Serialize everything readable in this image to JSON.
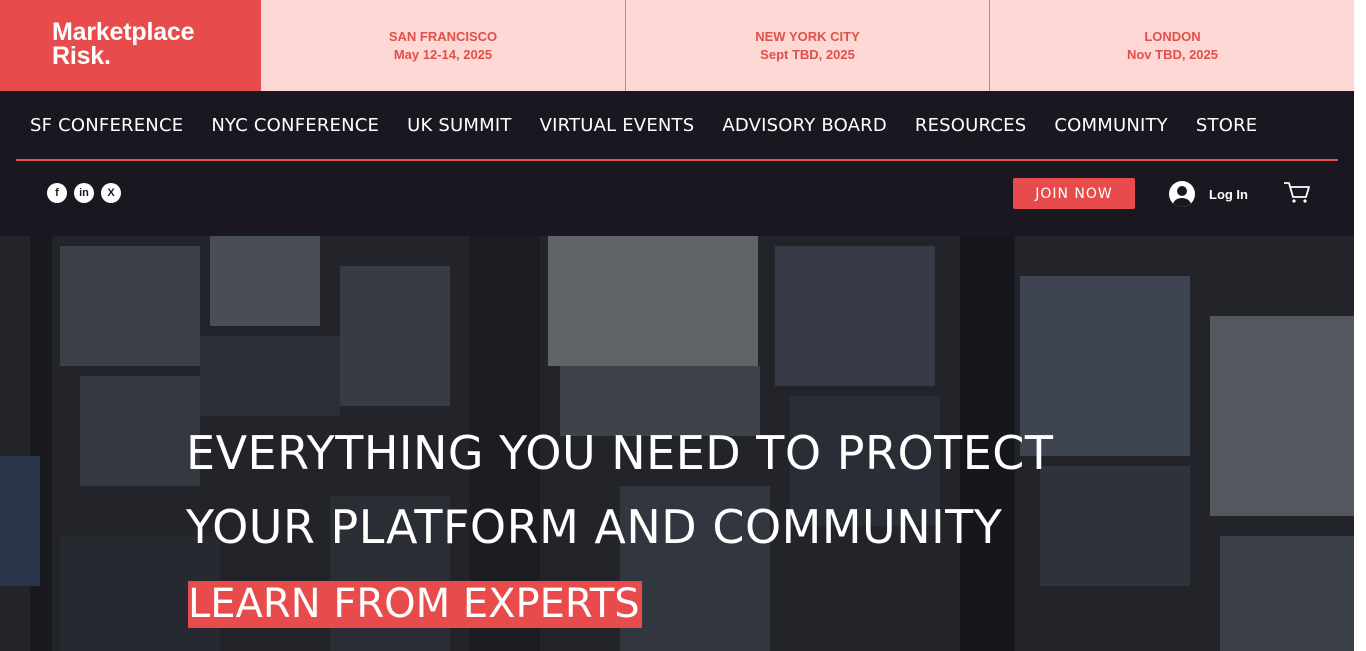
{
  "logo": {
    "line1": "Marketplace",
    "line2": "Risk."
  },
  "events": [
    {
      "city": "SAN FRANCISCO",
      "date": "May 12-14, 2025"
    },
    {
      "city": "NEW YORK CITY",
      "date": "Sept TBD, 2025"
    },
    {
      "city": "LONDON",
      "date": "Nov TBD, 2025"
    }
  ],
  "nav": {
    "items": [
      "SF CONFERENCE",
      "NYC CONFERENCE",
      "UK SUMMIT",
      "VIRTUAL EVENTS",
      "ADVISORY BOARD",
      "RESOURCES",
      "COMMUNITY",
      "STORE"
    ]
  },
  "social": {
    "facebook": "f",
    "linkedin": "in",
    "x": "X"
  },
  "actions": {
    "join_label": "JOIN NOW",
    "login_label": "Log In"
  },
  "hero": {
    "line1": "EVERYTHING YOU NEED TO PROTECT",
    "line2": "YOUR PLATFORM AND COMMUNITY",
    "highlight": "LEARN FROM EXPERTS"
  },
  "colors": {
    "brand_red": "#e84b4b",
    "event_bar_bg": "#fdd8d5",
    "nav_bg": "#1b1720",
    "event_text": "#e1504a"
  },
  "icons": [
    "facebook-icon",
    "linkedin-icon",
    "x-icon",
    "user-avatar-icon",
    "cart-icon"
  ]
}
